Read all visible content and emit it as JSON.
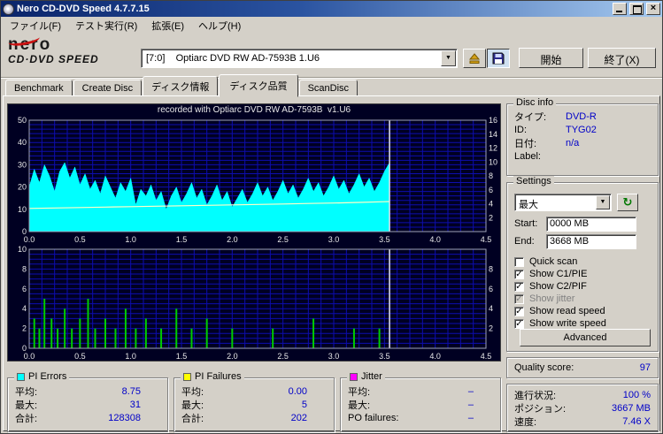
{
  "window": {
    "title": "Nero CD-DVD Speed 4.7.7.15"
  },
  "menu": {
    "items": [
      "ファイル(F)",
      "テスト実行(R)",
      "拡張(E)",
      "ヘルプ(H)"
    ]
  },
  "toolbar": {
    "logo_line1": "nero",
    "logo_line2": "CD·DVD SPEED",
    "drive_combo": "[7:0]    Optiarc DVD RW AD-7593B 1.U6",
    "start_label": "開始",
    "exit_label": "終了(X)"
  },
  "tabs": {
    "items": [
      {
        "label": "Benchmark"
      },
      {
        "label": "Create Disc"
      },
      {
        "label": "ディスク情報"
      },
      {
        "label": "ディスク品質"
      },
      {
        "label": "ScanDisc"
      }
    ],
    "active_index": 3
  },
  "chart_data": [
    {
      "type": "area",
      "name": "pi-errors-chart",
      "title": "recorded with Optiarc DVD RW AD-7593B  v1.U6",
      "x_range": [
        0,
        4.5
      ],
      "x_ticks": [
        0,
        0.5,
        1,
        1.5,
        2,
        2.5,
        3,
        3.5,
        4,
        4.5
      ],
      "x_unit": "GB",
      "y_left_range": [
        0,
        50
      ],
      "y_left_ticks": [
        50,
        40,
        30,
        20,
        10,
        0
      ],
      "y_right_range": [
        0,
        16
      ],
      "y_right_ticks": [
        16,
        14,
        12,
        10,
        8,
        6,
        4,
        2
      ],
      "grid": {
        "x_minor": 0.125,
        "y_minor": 2
      },
      "end_marker_x": 3.55,
      "series": [
        {
          "name": "PI Errors",
          "type": "area",
          "color": "#00ffff",
          "x_start": 0,
          "x_step": 0.05,
          "values": [
            20,
            28,
            22,
            30,
            25,
            18,
            27,
            31,
            24,
            29,
            21,
            26,
            19,
            23,
            17,
            25,
            20,
            15,
            22,
            18,
            24,
            12,
            19,
            16,
            21,
            14,
            18,
            10,
            16,
            20,
            13,
            17,
            22,
            15,
            19,
            12,
            16,
            21,
            14,
            18,
            11,
            15,
            19,
            13,
            17,
            22,
            16,
            20,
            14,
            18,
            23,
            17,
            21,
            15,
            19,
            24,
            18,
            22,
            16,
            20,
            25,
            19,
            23,
            17,
            21,
            26,
            20,
            24,
            18,
            22,
            27,
            31
          ]
        },
        {
          "name": "Write speed",
          "type": "line",
          "color": "#ffffc8",
          "points": [
            [
              0,
              10.4
            ],
            [
              0.25,
              10.6
            ],
            [
              0.5,
              10.8
            ],
            [
              0.75,
              11.0
            ],
            [
              1.0,
              11.2
            ],
            [
              1.25,
              11.4
            ],
            [
              1.5,
              11.6
            ],
            [
              1.75,
              11.8
            ],
            [
              2.0,
              12.0
            ],
            [
              2.25,
              12.2
            ],
            [
              2.5,
              12.4
            ],
            [
              2.75,
              12.6
            ],
            [
              3.0,
              12.8
            ],
            [
              3.25,
              13.1
            ],
            [
              3.5,
              13.4
            ],
            [
              3.55,
              13.5
            ]
          ]
        }
      ]
    },
    {
      "type": "bar",
      "name": "pi-failures-chart",
      "title": "",
      "x_range": [
        0,
        4.5
      ],
      "x_ticks": [
        0,
        0.5,
        1,
        1.5,
        2,
        2.5,
        3,
        3.5,
        4,
        4.5
      ],
      "x_unit": "GB",
      "y_left_range": [
        0,
        10
      ],
      "y_left_ticks": [
        10,
        8,
        6,
        4,
        2,
        0
      ],
      "y_right_range": [
        0,
        10
      ],
      "y_right_ticks": [
        8,
        6,
        4,
        2
      ],
      "grid": {
        "x_minor": 0.125,
        "y_minor": 0.5
      },
      "end_marker_x": 3.55,
      "series": [
        {
          "name": "PI Failures",
          "type": "spikes",
          "color": "#00cc00",
          "points": [
            [
              0.05,
              3
            ],
            [
              0.1,
              2
            ],
            [
              0.15,
              5
            ],
            [
              0.22,
              3
            ],
            [
              0.28,
              2
            ],
            [
              0.35,
              4
            ],
            [
              0.42,
              2
            ],
            [
              0.5,
              3
            ],
            [
              0.58,
              5
            ],
            [
              0.65,
              2
            ],
            [
              0.75,
              3
            ],
            [
              0.85,
              2
            ],
            [
              0.95,
              4
            ],
            [
              1.05,
              2
            ],
            [
              1.15,
              3
            ],
            [
              1.3,
              2
            ],
            [
              1.45,
              4
            ],
            [
              1.6,
              2
            ],
            [
              1.75,
              3
            ],
            [
              2.0,
              2
            ],
            [
              2.4,
              2
            ],
            [
              2.8,
              3
            ],
            [
              3.2,
              2
            ],
            [
              3.45,
              2
            ]
          ]
        }
      ]
    }
  ],
  "disc_info": {
    "title": "Disc info",
    "rows": [
      {
        "label": "タイプ:",
        "value": "DVD-R"
      },
      {
        "label": "ID:",
        "value": "TYG02"
      },
      {
        "label": "日付:",
        "value": "n/a"
      },
      {
        "label": "Label:",
        "value": ""
      }
    ]
  },
  "settings": {
    "title": "Settings",
    "speed_select": {
      "value": "最大"
    },
    "start": {
      "label": "Start:",
      "value": "0000 MB"
    },
    "end": {
      "label": "End:",
      "value": "3668 MB"
    },
    "checkboxes": [
      {
        "label": "Quick scan",
        "state": "unchecked"
      },
      {
        "label": "Show C1/PIE",
        "state": "checked"
      },
      {
        "label": "Show C2/PIF",
        "state": "checked"
      },
      {
        "label": "Show jitter",
        "state": "disabled-checked"
      },
      {
        "label": "Show read speed",
        "state": "checked"
      },
      {
        "label": "Show write speed",
        "state": "checked"
      }
    ],
    "advanced_label": "Advanced"
  },
  "quality": {
    "label": "Quality score:",
    "value": "97"
  },
  "progress": {
    "rows": [
      {
        "label": "進行状況:",
        "value": "100 %"
      },
      {
        "label": "ポジション:",
        "value": "3667 MB"
      },
      {
        "label": "速度:",
        "value": "7.46 X"
      }
    ]
  },
  "stats": [
    {
      "title": "PI Errors",
      "color": "#00ffff",
      "rows": [
        {
          "label": "平均:",
          "value": "8.75"
        },
        {
          "label": "最大:",
          "value": "31"
        },
        {
          "label": "合計:",
          "value": "128308"
        }
      ]
    },
    {
      "title": "PI Failures",
      "color": "#ffff00",
      "rows": [
        {
          "label": "平均:",
          "value": "0.00"
        },
        {
          "label": "最大:",
          "value": "5"
        },
        {
          "label": "合計:",
          "value": "202"
        }
      ]
    },
    {
      "title": "Jitter",
      "color": "#ff00ff",
      "rows": [
        {
          "label": "平均:",
          "value": "–"
        },
        {
          "label": "最大:",
          "value": "–"
        },
        {
          "label": "PO failures:",
          "value": "–"
        }
      ]
    }
  ]
}
